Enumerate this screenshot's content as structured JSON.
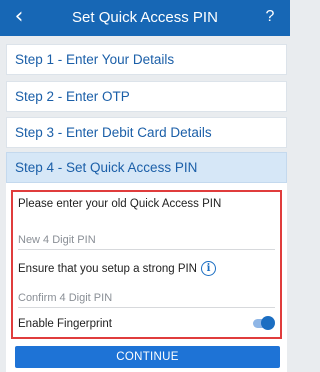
{
  "header": {
    "title": "Set Quick Access PIN",
    "back_icon": "chevron-left-icon",
    "back_glyph": "‹",
    "help_glyph": "?"
  },
  "steps": [
    {
      "label": "Step 1 - Enter Your Details"
    },
    {
      "label": "Step 2 - Enter OTP"
    },
    {
      "label": "Step 3 - Enter Debit Card Details"
    },
    {
      "label": "Step 4 - Set Quick Access PIN",
      "active": true
    }
  ],
  "form": {
    "instruction": "Please enter your old Quick Access PIN",
    "new_pin_placeholder": "New 4 Digit PIN",
    "strong_pin_note": "Ensure that you setup a strong PIN",
    "info_glyph": "i",
    "confirm_pin_placeholder": "Confirm 4 Digit PIN",
    "fingerprint_label": "Enable Fingerprint",
    "fingerprint_enabled": true,
    "continue_label": "CONTINUE"
  },
  "colors": {
    "header_bg": "#1767b5",
    "step_text": "#1b5fa8",
    "active_step_bg": "#d6e7f7",
    "highlight_border": "#e03c3c",
    "button_bg": "#1e73d6",
    "toggle_on": "#1b6ec2"
  }
}
